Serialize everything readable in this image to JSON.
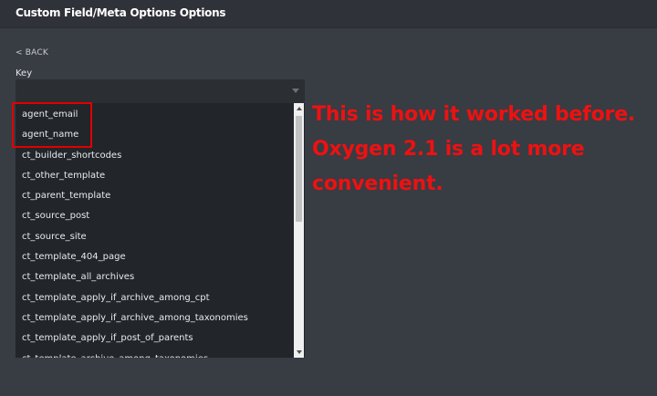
{
  "window": {
    "title": "Custom Field/Meta Options Options"
  },
  "nav": {
    "back_label": "< BACK"
  },
  "form": {
    "key_label": "Key",
    "key_value": ""
  },
  "dropdown": {
    "options": [
      "agent_email",
      "agent_name",
      "ct_builder_shortcodes",
      "ct_other_template",
      "ct_parent_template",
      "ct_source_post",
      "ct_source_site",
      "ct_template_404_page",
      "ct_template_all_archives",
      "ct_template_apply_if_archive_among_cpt",
      "ct_template_apply_if_archive_among_taxonomies",
      "ct_template_apply_if_post_of_parents",
      "ct_template_archive_among_taxonomies"
    ]
  },
  "annotation": {
    "lines": [
      "This is how it worked before.",
      "Oxygen 2.1 is a lot more",
      "convenient."
    ]
  },
  "colors": {
    "background": "#383c43",
    "titlebar": "#2f3238",
    "dropdown_bg": "#22252a",
    "annotation_red": "#ee1111"
  }
}
